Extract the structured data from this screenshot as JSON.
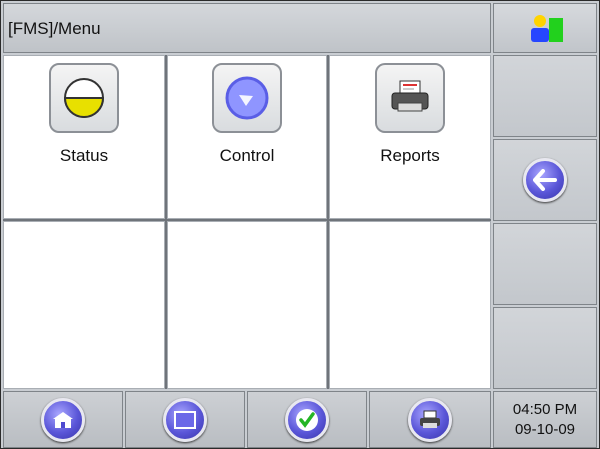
{
  "window": {
    "title": "[FMS]/Menu"
  },
  "menu": {
    "items": [
      {
        "label": "Status",
        "icon": "tank-level-icon"
      },
      {
        "label": "Control",
        "icon": "gauge-icon"
      },
      {
        "label": "Reports",
        "icon": "printer-icon"
      }
    ]
  },
  "sidebar": {
    "back_icon": "back-arrow-icon"
  },
  "bottom_bar": {
    "buttons": [
      {
        "icon": "home-icon"
      },
      {
        "icon": "menu-window-icon"
      },
      {
        "icon": "check-icon"
      },
      {
        "icon": "printer-icon"
      }
    ]
  },
  "status": {
    "time": "04:50 PM",
    "date": "09-10-09"
  },
  "colors": {
    "accent": "#5a56d8",
    "user_green": "#22d11d",
    "user_blue": "#2646ff",
    "user_yellow": "#ffd400"
  }
}
